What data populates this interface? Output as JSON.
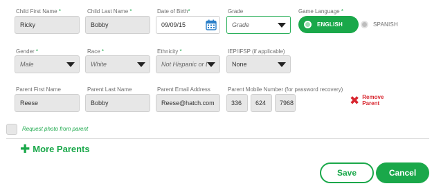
{
  "student": {
    "first_name": {
      "label": "Child First Name",
      "required": "*",
      "value": "Ricky"
    },
    "last_name": {
      "label": "Child Last Name",
      "required": "*",
      "value": "Bobby"
    },
    "dob": {
      "label": "Date of Birth",
      "required": "*",
      "value": "09/09/15"
    },
    "grade": {
      "label": "Grade",
      "value": "Grade"
    },
    "game_language": {
      "label": "Game Language",
      "required": "*",
      "options": [
        "ENGLISH",
        "SPANISH"
      ],
      "selected": "ENGLISH"
    },
    "gender": {
      "label": "Gender",
      "required": "*",
      "value": "Male"
    },
    "race": {
      "label": "Race",
      "required": "*",
      "value": "White"
    },
    "ethnicity": {
      "label": "Ethnicity",
      "required": "*",
      "value": "Not Hispanic or Lat"
    },
    "iep": {
      "label": "IEP/IFSP (if applicable)",
      "value": "None"
    }
  },
  "parent": {
    "first_name": {
      "label": "Parent First Name",
      "value": "Reese"
    },
    "last_name": {
      "label": "Parent Last Name",
      "value": "Bobby"
    },
    "email": {
      "label": "Parent Email Address",
      "value": "Reese@hatch.com"
    },
    "mobile": {
      "label": "Parent Mobile Number (for password recovery)",
      "part1": "336",
      "part2": "624",
      "part3": "7968"
    },
    "remove_line1": "Remove",
    "remove_line2": "Parent"
  },
  "request_photo_label": "Request photo from parent",
  "more_parents_label": "More Parents",
  "buttons": {
    "save": "Save",
    "cancel": "Cancel"
  },
  "icons": {
    "calendar": "calendar-icon",
    "remove": "close-x-icon",
    "add": "plus-icon"
  },
  "colors": {
    "accent": "#1aa84a",
    "danger": "#d8262f"
  }
}
